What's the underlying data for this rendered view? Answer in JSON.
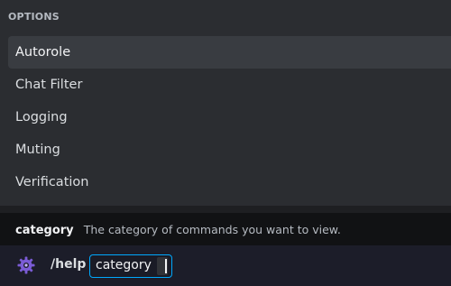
{
  "popup": {
    "header": "OPTIONS",
    "options": [
      {
        "label": "Autorole"
      },
      {
        "label": "Chat Filter"
      },
      {
        "label": "Logging"
      },
      {
        "label": "Muting"
      },
      {
        "label": "Verification"
      }
    ]
  },
  "hint": {
    "name": "category",
    "description": "The category of commands you want to view."
  },
  "composer": {
    "command": "/help",
    "param_label": "category",
    "param_value": "",
    "bot_icon": "gear-icon"
  },
  "colors": {
    "accent": "#00a8fc",
    "active_option_bg": "#393c41",
    "bot_icon": "#7b5cd6"
  }
}
